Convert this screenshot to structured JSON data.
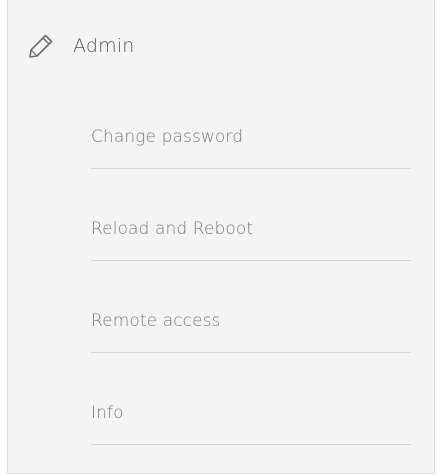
{
  "section": {
    "icon": "pencil-icon",
    "title": "Admin"
  },
  "menu": {
    "items": [
      {
        "label": "Change password"
      },
      {
        "label": "Reload and Reboot"
      },
      {
        "label": "Remote access"
      },
      {
        "label": "Info"
      }
    ]
  },
  "colors": {
    "panel_background": "#f4f4f4",
    "divider": "#d6d6d6",
    "title_text": "#555555",
    "menu_text": "#7a7a7a"
  }
}
